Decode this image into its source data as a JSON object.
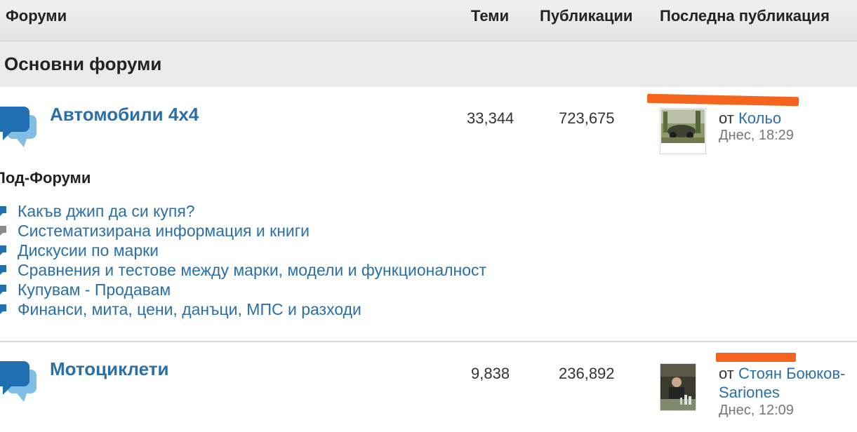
{
  "header": {
    "forums": "Форуми",
    "topics": "Теми",
    "posts": "Публикации",
    "last_post": "Последна публикация"
  },
  "category": {
    "title": "Основни форуми"
  },
  "forums": [
    {
      "title": "Автомобили 4x4",
      "topics": "33,344",
      "posts": "723,675",
      "last_by_prefix": "от ",
      "last_author": "Кольо",
      "last_date": "Днес, 18:29",
      "subforums_label": "Под-Форуми",
      "subforums": [
        {
          "label": "Какъв джип да си купя?",
          "icon": "forum-icon-blue"
        },
        {
          "label": "Систематизирана информация и книги",
          "icon": "forum-icon-gray"
        },
        {
          "label": "Дискусии по марки",
          "icon": "forum-icon-blue"
        },
        {
          "label": "Сравнения и тестове между марки, модели и функционалност",
          "icon": "forum-icon-blue"
        },
        {
          "label": "Купувам - Продавам",
          "icon": "forum-icon-blue"
        },
        {
          "label": "Финанси, мита, цени, данъци, МПС и разходи",
          "icon": "forum-icon-blue"
        }
      ]
    },
    {
      "title": "Мотоциклети",
      "topics": "9,838",
      "posts": "236,892",
      "last_by_prefix": "от ",
      "last_author": "Стоян Боюков-",
      "last_author_cont": "Sariones",
      "last_date": "Днес, 12:09"
    }
  ],
  "colors": {
    "link": "#2a6fa8",
    "icon_blue": "#1f6fb2",
    "icon_gray": "#8a8a8a",
    "redaction": "#f4641d"
  }
}
